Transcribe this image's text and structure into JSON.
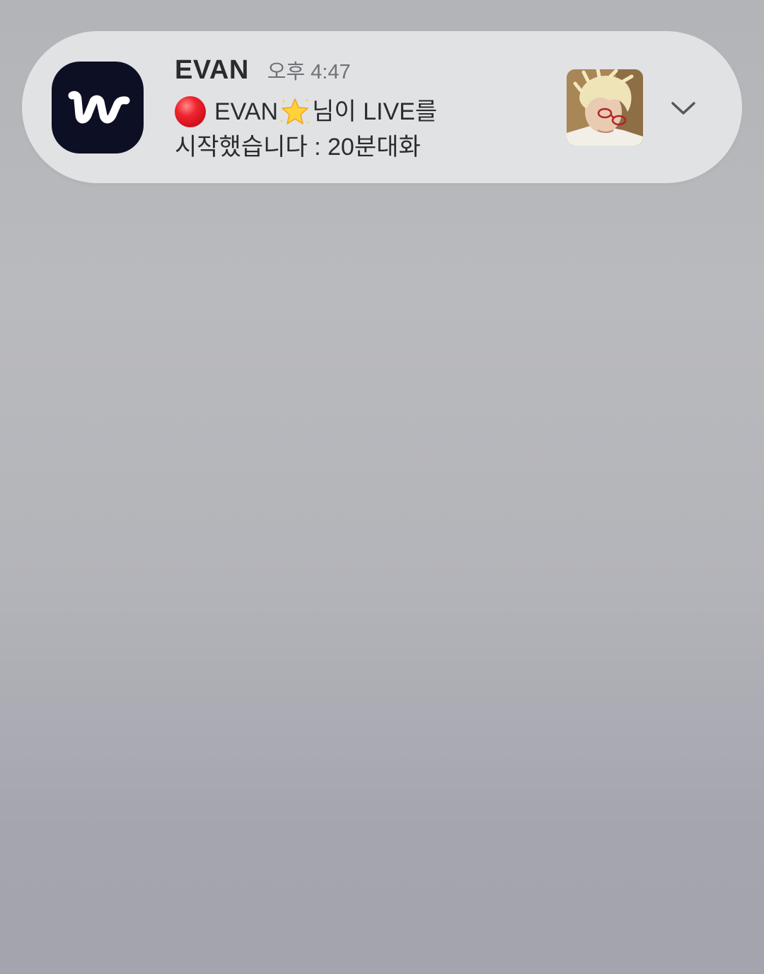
{
  "notification": {
    "app_icon": "weverse-logo-icon",
    "app_name": "EVAN",
    "timestamp": "오후 4:47",
    "message": {
      "live_indicator_icon": "red-circle-icon",
      "name": "EVAN",
      "name_decoration_icon": "glowing-star-icon",
      "line1_suffix": "님이 LIVE를",
      "line2": "시작했습니다 : 20분대화"
    },
    "thumbnail": "profile-photo",
    "expand_icon": "chevron-down-icon"
  },
  "colors": {
    "notification_bg": "#e1e2e4",
    "app_icon_bg": "#0d0f24",
    "live_red": "#e8212b",
    "star_yellow": "#ffd23a"
  }
}
